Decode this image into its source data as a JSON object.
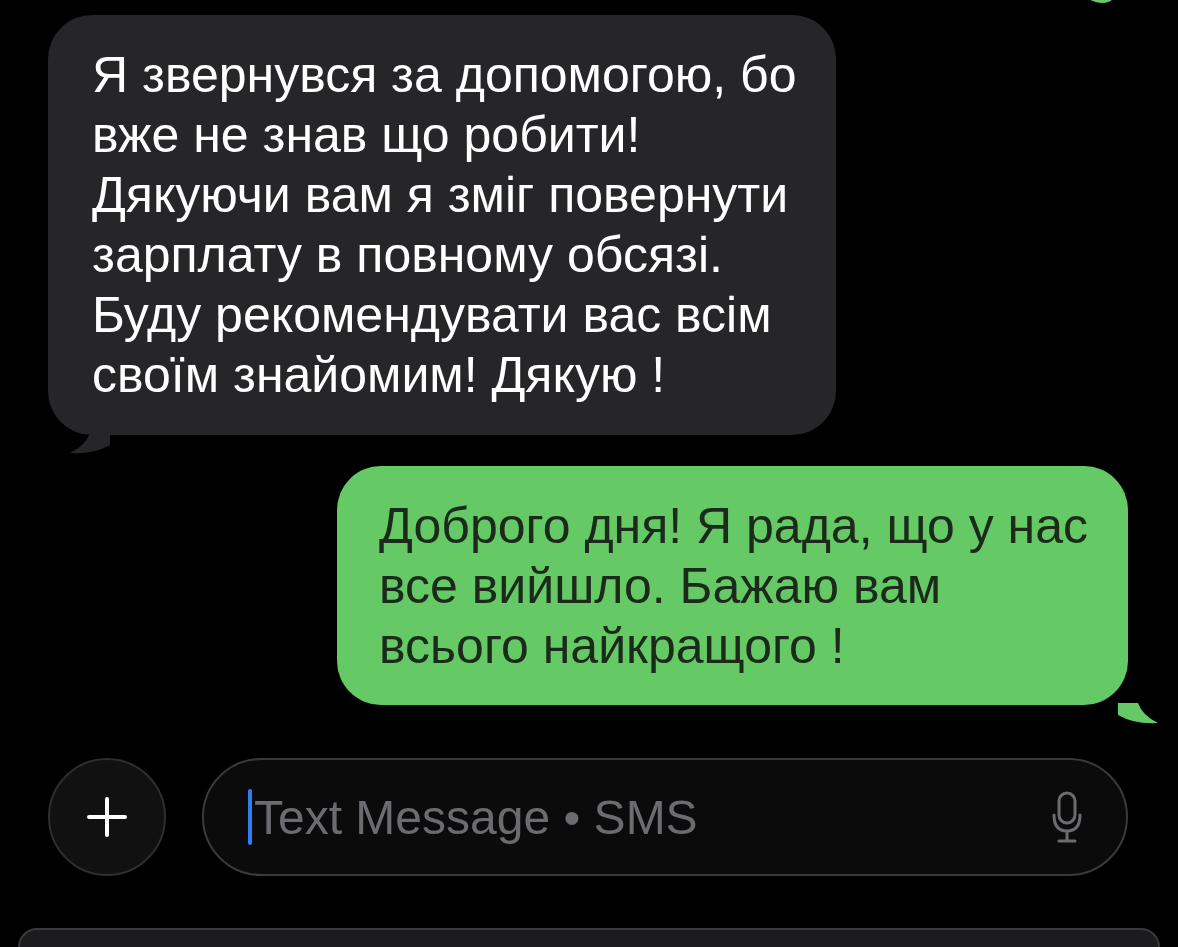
{
  "messages": [
    {
      "kind": "received",
      "text": "Я звернувся за допомогою, бо\nвже не знав що робити!\nДякуючи вам я зміг повернути\nзарплату в повному обсязі.\nБуду рекомендувати вас всім\nсвоїм знайомим! Дякую !"
    },
    {
      "kind": "sent",
      "text": "Доброго дня! Я рада, що у нас\nвсе вийшло. Бажаю вам\nвсього найкращого !"
    }
  ],
  "composer": {
    "placeholder": "Text Message • SMS"
  }
}
